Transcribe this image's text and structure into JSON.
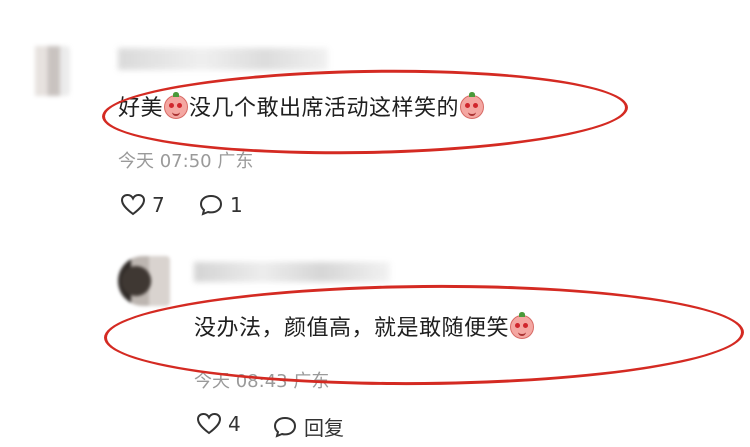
{
  "comments": [
    {
      "text_before": "好美",
      "text_middle": "没几个敢出席活动这样笑的",
      "time": "今天 07:50",
      "location": "广东",
      "likes": "7",
      "replies": "1"
    },
    {
      "text_before": "没办法，颜值高，就是敢随便笑",
      "time": "今天 08:43",
      "location": "广东",
      "likes": "4",
      "reply_label": "回复"
    }
  ],
  "colors": {
    "highlight_ellipse": "#d42a22",
    "meta_text": "#9a9a9a"
  },
  "icons": [
    "heart-icon",
    "comment-bubble-icon",
    "emoji-icon"
  ]
}
